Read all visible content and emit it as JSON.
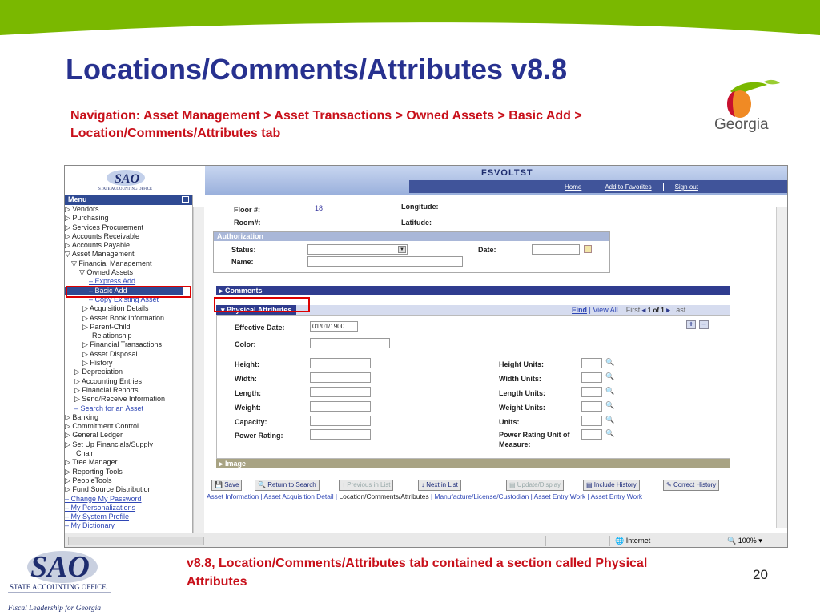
{
  "slide": {
    "title": "Locations/Comments/Attributes v8.8",
    "navigation": "Navigation: Asset Management > Asset Transactions > Owned Assets > Basic Add > Location/Comments/Attributes tab",
    "caption": "v8.8, Location/Comments/Attributes tab contained a section called Physical Attributes",
    "page_number": "20",
    "georgia_logo_text": "Georgia",
    "sao_logo_text": "SAO",
    "sao_subtitle": "STATE ACCOUNTING OFFICE",
    "sao_tagline": "Fiscal Leadership for Georgia",
    "colors": {
      "title": "#27318f",
      "red_text": "#c8101a",
      "section_bar": "#2f3c8f"
    }
  },
  "app": {
    "header_title": "FSVOLTST",
    "header_links": [
      "Home",
      "Add to Favorites",
      "Sign out"
    ],
    "header_logo": "SAO",
    "header_logo_sub": "STATE ACCOUNTING OFFICE"
  },
  "menu": {
    "title": "Menu",
    "items": [
      "▷ Vendors",
      "▷ Purchasing",
      "▷ Services Procurement",
      "▷ Accounts Receivable",
      "▷ Accounts Payable",
      "▽ Asset Management",
      "▽ Financial Management",
      "▽ Owned Assets",
      "– Express Add",
      "– Basic Add",
      "– Copy Existing Asset",
      "▷ Acquisition Details",
      "▷ Asset Book Information",
      "▷ Parent-Child",
      "Relationship",
      "▷ Financial Transactions",
      "▷ Asset Disposal",
      "▷ History",
      "▷ Depreciation",
      "▷ Accounting Entries",
      "▷ Financial Reports",
      "▷ Send/Receive Information",
      "– Search for an Asset",
      "▷ Banking",
      "▷ Commitment Control",
      "▷ General Ledger",
      "▷ Set Up Financials/Supply",
      "Chain",
      "▷ Tree Manager",
      "▷ Reporting Tools",
      "▷ PeopleTools",
      "▷ Fund Source Distribution",
      "– Change My Password",
      "– My Personalizations",
      "– My System Profile",
      "– My Dictionary"
    ]
  },
  "location": {
    "floor_label": "Floor #:",
    "floor_value": "18",
    "longitude_label": "Longitude:",
    "room_label": "Room#:",
    "latitude_label": "Latitude:"
  },
  "authorization": {
    "header": "Authorization",
    "status_label": "Status:",
    "date_label": "Date:",
    "name_label": "Name:"
  },
  "sections": {
    "comments": "Comments",
    "physical_attributes": "Physical Attributes",
    "image": "Image"
  },
  "phys_nav": {
    "find": "Find",
    "view_all": "View All",
    "first": "First",
    "count": "1 of 1",
    "last": "Last"
  },
  "physical": {
    "effective_date_label": "Effective Date:",
    "effective_date_value": "01/01/1900",
    "color_label": "Color:",
    "height_label": "Height:",
    "width_label": "Width:",
    "length_label": "Length:",
    "weight_label": "Weight:",
    "capacity_label": "Capacity:",
    "power_rating_label": "Power Rating:",
    "height_units_label": "Height Units:",
    "width_units_label": "Width Units:",
    "length_units_label": "Length Units:",
    "weight_units_label": "Weight Units:",
    "units_label": "Units:",
    "power_rating_unit_label": "Power Rating Unit of",
    "power_rating_unit_label2": "Measure:"
  },
  "buttons": {
    "save": "Save",
    "return_to_search": "Return to Search",
    "previous_in_list": "Previous in List",
    "next_in_list": "Next in List",
    "update_display": "Update/Display",
    "include_history": "Include History",
    "correct_history": "Correct History"
  },
  "page_tabs": {
    "asset_information": "Asset Information",
    "asset_acquisition_detail": "Asset Acquisition Detail",
    "location_comments_attributes": "Location/Comments/Attributes",
    "manufacture": "Manufacture/License/Custodian",
    "asset_entry_work": "Asset Entry Work",
    "asset_entry_work2": "Asset Entry Work"
  },
  "statusbar": {
    "zone": "Internet",
    "zoom": "100%"
  }
}
